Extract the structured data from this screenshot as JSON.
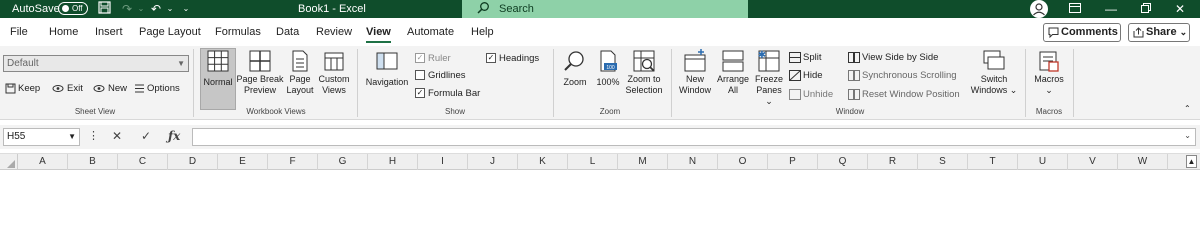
{
  "titlebar": {
    "autosave_label": "AutoSave",
    "autosave_state": "Off",
    "doc_title": "Book1  -  Excel",
    "search_placeholder": "Search"
  },
  "menu": {
    "items": [
      "File",
      "Home",
      "Insert",
      "Page Layout",
      "Formulas",
      "Data",
      "Review",
      "View",
      "Automate",
      "Help"
    ],
    "active": "View",
    "comments_label": "Comments",
    "share_label": "Share",
    "share_chevron": "⌄"
  },
  "ribbon": {
    "sheet_view": {
      "select_value": "Default",
      "keep": "Keep",
      "exit": "Exit",
      "new": "New",
      "options": "Options",
      "label": "Sheet View"
    },
    "workbook_views": {
      "normal": "Normal",
      "page_break_1": "Page Break",
      "page_break_2": "Preview",
      "page_layout_1": "Page",
      "page_layout_2": "Layout",
      "custom_1": "Custom",
      "custom_2": "Views",
      "label": "Workbook Views"
    },
    "show": {
      "navigation": "Navigation",
      "ruler": "Ruler",
      "ruler_checked": true,
      "gridlines": "Gridlines",
      "gridlines_checked": false,
      "formula_bar": "Formula Bar",
      "formula_bar_checked": true,
      "headings": "Headings",
      "headings_checked": true,
      "label": "Show"
    },
    "zoom": {
      "zoom": "Zoom",
      "hundred": "100%",
      "selection_1": "Zoom to",
      "selection_2": "Selection",
      "label": "Zoom"
    },
    "window": {
      "new_1": "New",
      "new_2": "Window",
      "arrange_1": "Arrange",
      "arrange_2": "All",
      "freeze_1": "Freeze",
      "freeze_2": "Panes ⌄",
      "split": "Split",
      "hide": "Hide",
      "unhide": "Unhide",
      "side_by_side": "View Side by Side",
      "sync": "Synchronous Scrolling",
      "reset": "Reset Window Position",
      "switch_1": "Switch",
      "switch_2": "Windows ⌄",
      "label": "Window"
    },
    "macros": {
      "macros_1": "Macros",
      "macros_2": "⌄",
      "label": "Macros"
    }
  },
  "formula_bar": {
    "name_box": "H55",
    "formula": ""
  },
  "columns": [
    "A",
    "B",
    "C",
    "D",
    "E",
    "F",
    "G",
    "H",
    "I",
    "J",
    "K",
    "L",
    "M",
    "N",
    "O",
    "P",
    "Q",
    "R",
    "S",
    "T",
    "U",
    "V",
    "W"
  ],
  "colors": {
    "titlebar": "#0f4d2b",
    "search": "#8ed1a8",
    "accent": "#1e7145"
  }
}
